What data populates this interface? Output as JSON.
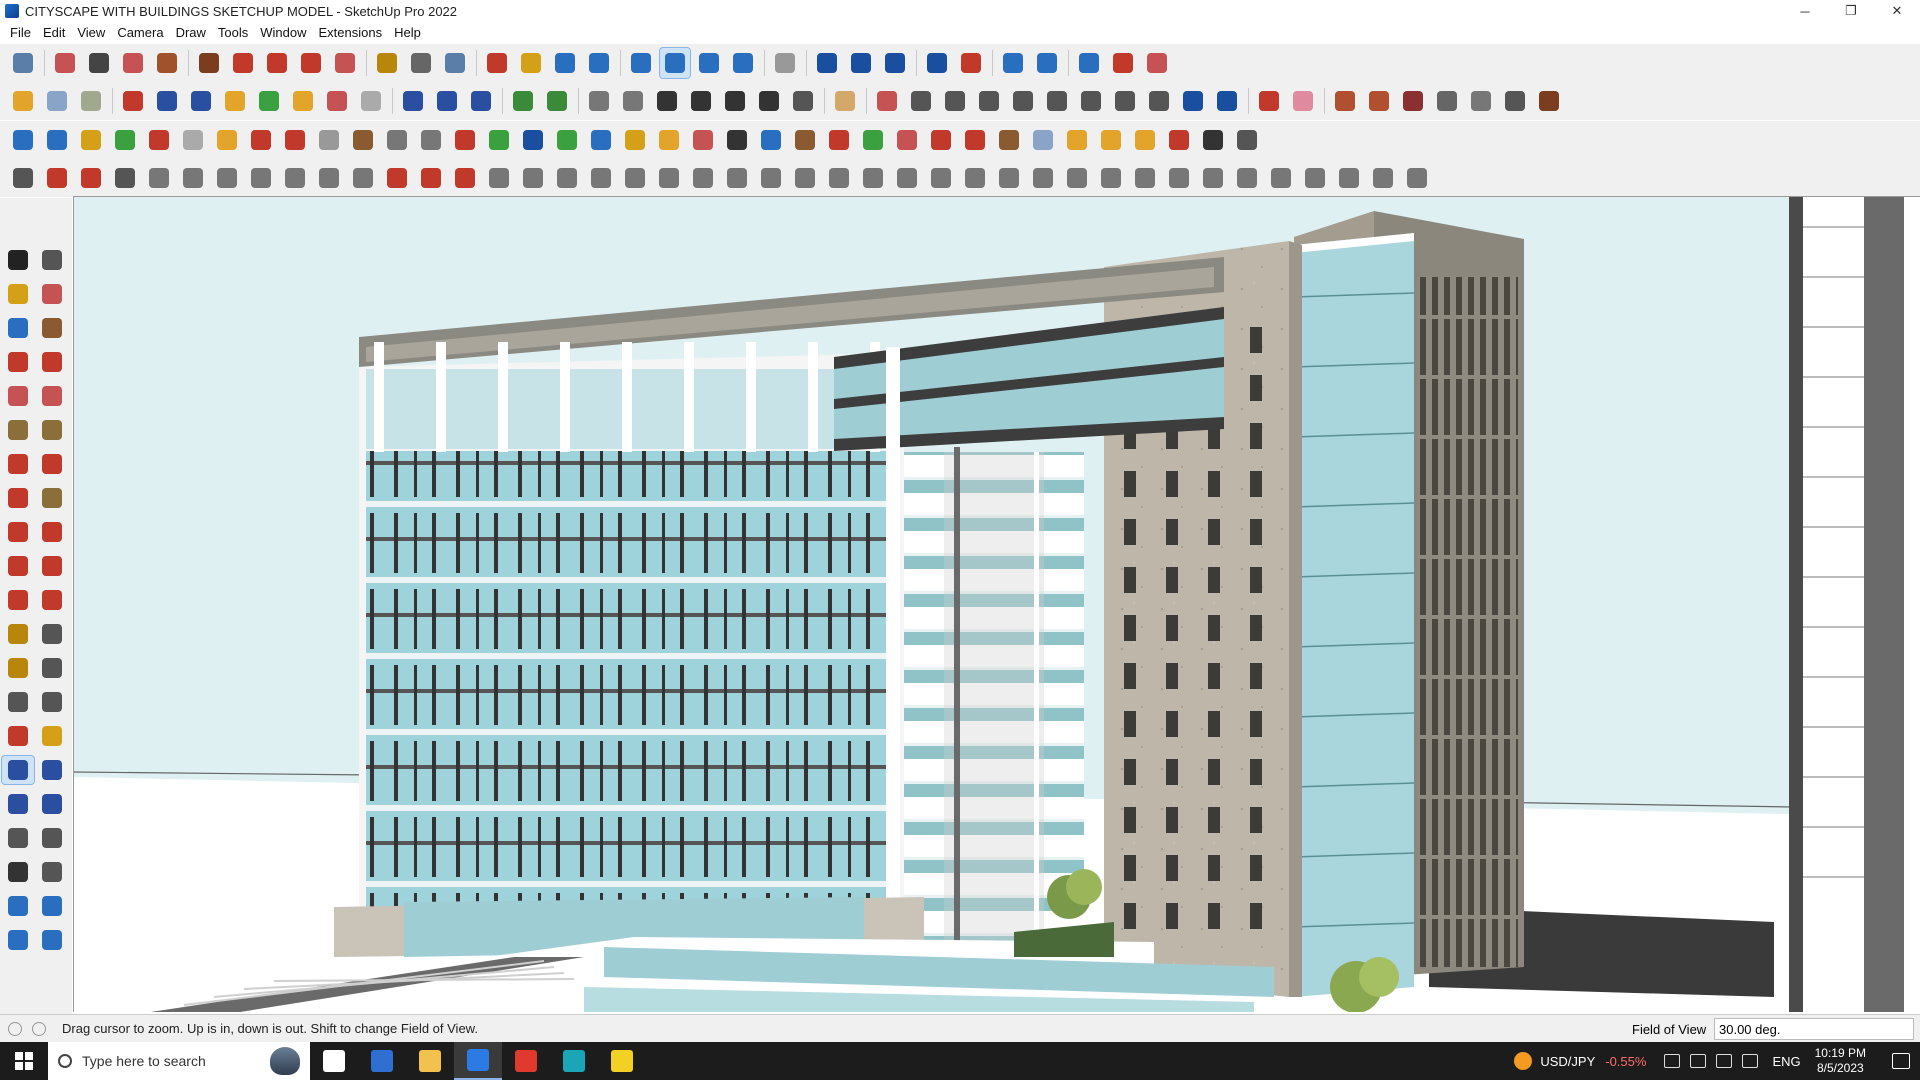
{
  "window": {
    "title": "CITYSCAPE WITH BUILDINGS SKETCHUP MODEL - SketchUp Pro 2022",
    "controls": [
      {
        "name": "minimize-button",
        "glyph": "─"
      },
      {
        "name": "restore-button",
        "glyph": "❐"
      },
      {
        "name": "close-button",
        "glyph": "✕"
      }
    ]
  },
  "menu": [
    "File",
    "Edit",
    "View",
    "Camera",
    "Draw",
    "Tools",
    "Window",
    "Extensions",
    "Help"
  ],
  "toolbars": [
    [
      "#5a7ea8",
      "|",
      "#c65353",
      "#444",
      "#c65353",
      "#a0522d",
      "|",
      "#7a3d1e",
      "#c0392b",
      "#c0392b",
      "#c0392b",
      "#c65353",
      "|",
      "#b8860b",
      "#666",
      "#5a7ea8",
      "|",
      "#c0392b",
      "#d4a017",
      "#2a6fbf",
      "#2a6fbf",
      "|",
      "#2a6fbf",
      "#2a6fbf",
      "#2a6fbf",
      "#2a6fbf",
      "|",
      "#999",
      "|",
      "#1a4fa0",
      "#1a4fa0",
      "#1a4fa0",
      "|",
      "#1a4fa0",
      "#c0392b",
      "|",
      "#2a6fbf",
      "#2a6fbf",
      "|",
      "#2a6fbf",
      "#c0392b",
      "#c65353"
    ],
    [
      "#e2a42b",
      "#8aa4c8",
      "#a0a890",
      "|",
      "#c0392b",
      "#2a4fa0",
      "#2a4fa0",
      "#e2a42b",
      "#3aa040",
      "#e2a42b",
      "#c65353",
      "#aaa",
      "|",
      "#2a4fa0",
      "#2a4fa0",
      "#2a4fa0",
      "|",
      "#3a8a3a",
      "#3a8a3a",
      "|",
      "#777",
      "#777",
      "#333",
      "#333",
      "#333",
      "#333",
      "#555",
      "|",
      "#d4a76a",
      "|",
      "#c65353",
      "#555",
      "#555",
      "#555",
      "#555",
      "#555",
      "#555",
      "#555",
      "#555",
      "#1a4fa0",
      "#1a4fa0",
      "|",
      "#c0392b",
      "#e08aa0",
      "|",
      "#b05030",
      "#b05030",
      "#8a3030",
      "#666",
      "#777",
      "#555",
      "#7a3d1e"
    ],
    [
      "#2a6fbf",
      "#2a6fbf",
      "#d4a017",
      "#3aa040",
      "#c0392b",
      "#aaa",
      "#e2a42b",
      "#c0392b",
      "#c0392b",
      "#999",
      "#8a5a30",
      "#777",
      "#777",
      "#c0392b",
      "#3aa040",
      "#1a4fa0",
      "#3aa040",
      "#2a6fbf",
      "#d4a017",
      "#e2a42b",
      "#c65353",
      "#333",
      "#2a6fbf",
      "#8a5a30",
      "#c0392b",
      "#3aa040",
      "#c65353",
      "#c0392b",
      "#c0392b",
      "#8a5a30",
      "#8aa4c8",
      "#e2a42b",
      "#e2a42b",
      "#e2a42b",
      "#c0392b",
      "#333",
      "#555"
    ],
    [
      "#555",
      "#c0392b",
      "#c0392b",
      "#555",
      "#777",
      "#777",
      "#777",
      "#777",
      "#777",
      "#777",
      "#777",
      "#c0392b",
      "#c0392b",
      "#c0392b",
      "#777",
      "#777",
      "#777",
      "#777",
      "#777",
      "#777",
      "#777",
      "#777",
      "#777",
      "#777",
      "#777",
      "#777",
      "#777",
      "#777",
      "#777",
      "#777",
      "#777",
      "#777",
      "#777",
      "#777",
      "#777",
      "#777",
      "#777",
      "#777",
      "#777",
      "#777",
      "#777",
      "#777"
    ]
  ],
  "left_palette": [
    "#222",
    "#555",
    "#d4a017",
    "#c65353",
    "#2a6fbf",
    "#8a5a30",
    "#c0392b",
    "#c0392b",
    "#c65353",
    "#c65353",
    "#8a6f3a",
    "#8a6f3a",
    "#c0392b",
    "#c0392b",
    "#c0392b",
    "#8a6f3a",
    "#c0392b",
    "#c0392b",
    "#c0392b",
    "#c0392b",
    "#c0392b",
    "#c0392b",
    "#b8860b",
    "#555",
    "#b8860b",
    "#555",
    "#555",
    "#555",
    "#c0392b",
    "#d4a017",
    "#2a4fa0",
    "#2a4fa0",
    "#2a4fa0",
    "#2a4fa0",
    "#555",
    "#555",
    "#333",
    "#555",
    "#2a6fbf",
    "#2a6fbf",
    "#2a6fbf",
    "#2a6fbf"
  ],
  "status": {
    "hint": "Drag cursor to zoom.  Up is in, down is out. Shift to change Field of View.",
    "vcb_label": "Field of View",
    "vcb_value": "30.00 deg."
  },
  "taskbar": {
    "search_placeholder": "Type here to search",
    "apps": [
      {
        "name": "task-view-button",
        "color": "#ffffff"
      },
      {
        "name": "calculator-app",
        "color": "#2f6fd1"
      },
      {
        "name": "file-explorer-app",
        "color": "#f2c14e"
      },
      {
        "name": "sketchup-app",
        "color": "#2c7be5",
        "active": true
      },
      {
        "name": "acrobat-app",
        "color": "#e03a2f"
      },
      {
        "name": "edge-app",
        "color": "#1aa6b7"
      },
      {
        "name": "sticky-notes-app",
        "color": "#f2d024"
      }
    ],
    "ticker_name": "USD/JPY",
    "ticker_change": "-0.55%",
    "language": "ENG",
    "time": "10:19 PM",
    "date": "8/5/2023"
  }
}
